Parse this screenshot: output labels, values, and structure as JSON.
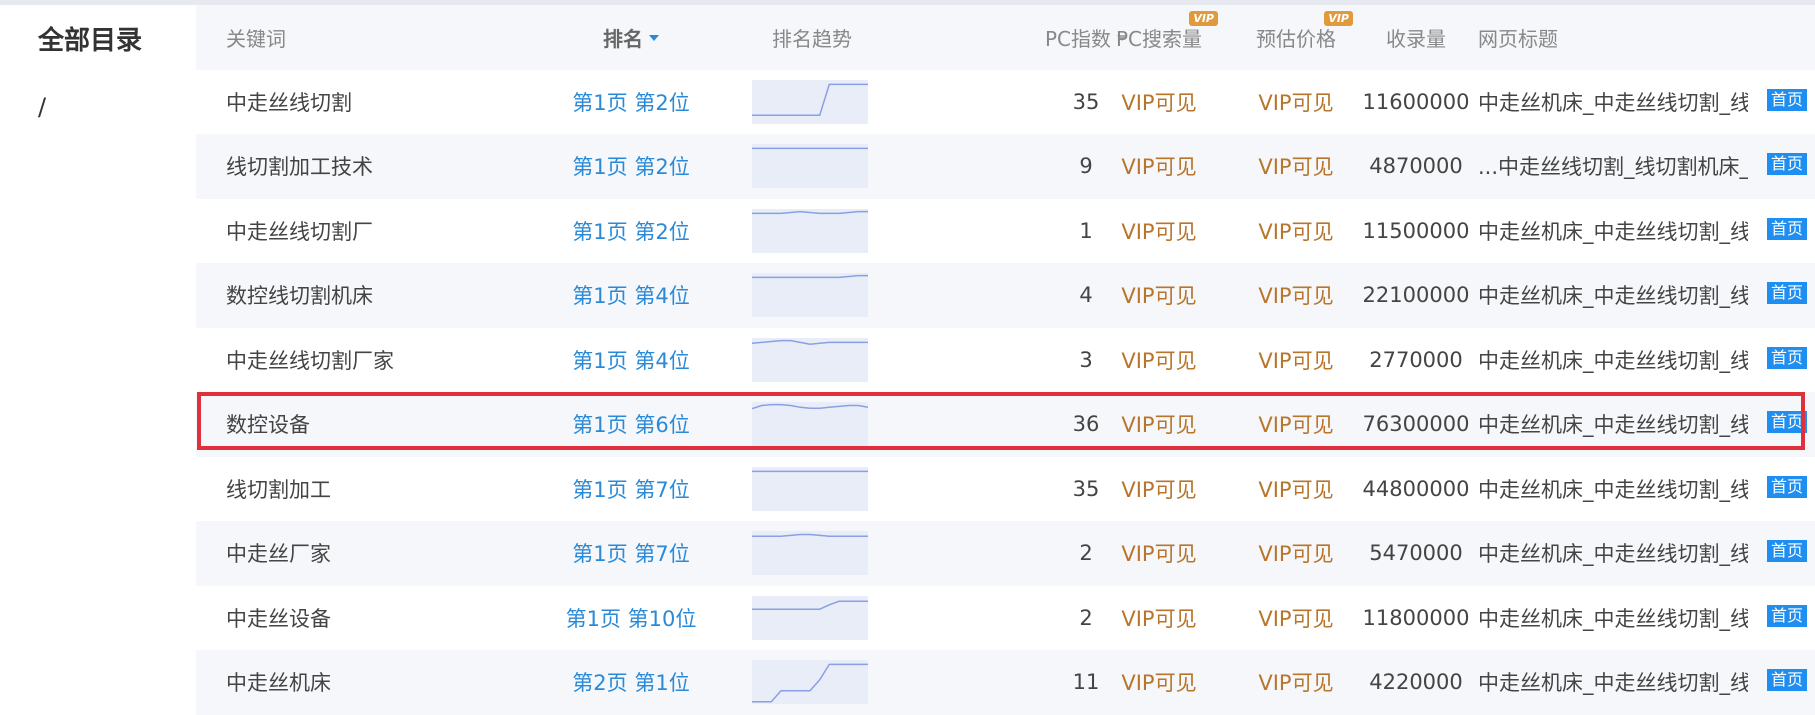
{
  "sidebar": {
    "title": "全部目录",
    "path": "/"
  },
  "header": {
    "keyword": "关键词",
    "rank": "排名",
    "trend": "排名趋势",
    "pc_index": "PC指数",
    "pc_volume": "PC搜索量",
    "price": "预估价格",
    "indexed": "收录量",
    "page_title": "网页标题",
    "vip_badge": "VIP"
  },
  "tag_label": "首页",
  "rows": [
    {
      "keyword": "中走丝线切割",
      "rank": "第1页 第2位",
      "trend": [
        0.8,
        0.8,
        0.8,
        0.8,
        0.8,
        0.8,
        0.8,
        0.8,
        0.1,
        0.1,
        0.1,
        0.1,
        0.1
      ],
      "pc_index": "35",
      "pc_volume": "VIP可见",
      "price": "VIP可见",
      "indexed": "11600000",
      "title": "中走丝机床_中走丝线切割_线"
    },
    {
      "keyword": "线切割加工技术",
      "rank": "第1页 第2位",
      "trend": [
        0.1,
        0.1,
        0.1,
        0.1,
        0.1,
        0.1,
        0.1,
        0.1,
        0.1,
        0.1,
        0.1,
        0.1,
        0.1
      ],
      "pc_index": "9",
      "pc_volume": "VIP可见",
      "price": "VIP可见",
      "indexed": "4870000",
      "title": "...中走丝线切割_线切割机床_数"
    },
    {
      "keyword": "中走丝线切割厂",
      "rank": "第1页 第2位",
      "trend": [
        0.1,
        0.1,
        0.1,
        0.1,
        0.08,
        0.06,
        0.08,
        0.1,
        0.1,
        0.1,
        0.08,
        0.06,
        0.06
      ],
      "pc_index": "1",
      "pc_volume": "VIP可见",
      "price": "VIP可见",
      "indexed": "11500000",
      "title": "中走丝机床_中走丝线切割_线"
    },
    {
      "keyword": "数控线切割机床",
      "rank": "第1页 第4位",
      "trend": [
        0.1,
        0.1,
        0.1,
        0.1,
        0.1,
        0.1,
        0.1,
        0.1,
        0.1,
        0.1,
        0.08,
        0.06,
        0.06
      ],
      "pc_index": "4",
      "pc_volume": "VIP可见",
      "price": "VIP可见",
      "indexed": "22100000",
      "title": "中走丝机床_中走丝线切割_线"
    },
    {
      "keyword": "中走丝线切割厂家",
      "rank": "第1页 第4位",
      "trend": [
        0.12,
        0.1,
        0.08,
        0.06,
        0.06,
        0.1,
        0.14,
        0.12,
        0.1,
        0.1,
        0.1,
        0.1,
        0.1
      ],
      "pc_index": "3",
      "pc_volume": "VIP可见",
      "price": "VIP可见",
      "indexed": "2770000",
      "title": "中走丝机床_中走丝线切割_线"
    },
    {
      "keyword": "数控设备",
      "rank": "第1页 第6位",
      "trend": [
        0.15,
        0.08,
        0.06,
        0.06,
        0.08,
        0.12,
        0.14,
        0.14,
        0.12,
        0.1,
        0.08,
        0.08,
        0.12
      ],
      "pc_index": "36",
      "pc_volume": "VIP可见",
      "price": "VIP可见",
      "indexed": "76300000",
      "title": "中走丝机床_中走丝线切割_线"
    },
    {
      "keyword": "线切割加工",
      "rank": "第1页 第7位",
      "trend": [
        0.1,
        0.1,
        0.1,
        0.1,
        0.1,
        0.1,
        0.1,
        0.1,
        0.1,
        0.1,
        0.1,
        0.1,
        0.1
      ],
      "pc_index": "35",
      "pc_volume": "VIP可见",
      "price": "VIP可见",
      "indexed": "44800000",
      "title": "中走丝机床_中走丝线切割_线"
    },
    {
      "keyword": "中走丝厂家",
      "rank": "第1页 第7位",
      "trend": [
        0.12,
        0.12,
        0.12,
        0.12,
        0.1,
        0.08,
        0.08,
        0.1,
        0.12,
        0.12,
        0.12,
        0.12,
        0.12
      ],
      "pc_index": "2",
      "pc_volume": "VIP可见",
      "price": "VIP可见",
      "indexed": "5470000",
      "title": "中走丝机床_中走丝线切割_线"
    },
    {
      "keyword": "中走丝设备",
      "rank": "第1页 第10位",
      "trend": [
        0.3,
        0.3,
        0.3,
        0.3,
        0.3,
        0.3,
        0.3,
        0.3,
        0.2,
        0.12,
        0.12,
        0.12,
        0.12
      ],
      "pc_index": "2",
      "pc_volume": "VIP可见",
      "price": "VIP可见",
      "indexed": "11800000",
      "title": "中走丝机床_中走丝线切割_线"
    },
    {
      "keyword": "中走丝机床",
      "rank": "第2页 第1位",
      "trend": [
        0.95,
        0.95,
        0.95,
        0.7,
        0.7,
        0.7,
        0.7,
        0.45,
        0.1,
        0.1,
        0.1,
        0.1,
        0.1
      ],
      "pc_index": "11",
      "pc_volume": "VIP可见",
      "price": "VIP可见",
      "indexed": "4220000",
      "title": "中走丝机床_中走丝线切割_线"
    }
  ],
  "highlighted_row_index": 5,
  "colors": {
    "link": "#2a8ad8",
    "vip_text": "#b8752b",
    "tag_bg": "#1f8ef1",
    "highlight_border": "#e0303b",
    "trend_line": "#8aa0e6"
  }
}
